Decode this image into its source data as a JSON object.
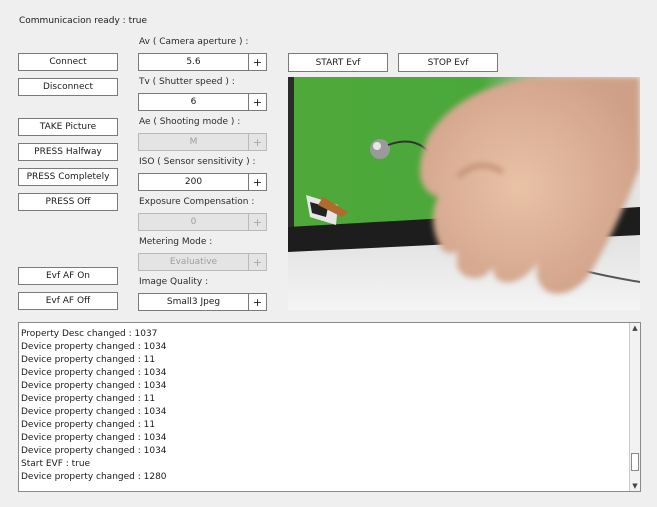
{
  "status": {
    "text": "Communicacion ready : true"
  },
  "left_buttons": {
    "connect": "Connect",
    "disconnect": "Disconnect",
    "take_picture": "TAKE Picture",
    "press_halfway": "PRESS Halfway",
    "press_completely": "PRESS Completely",
    "press_off": "PRESS Off",
    "evf_af_on": "Evf AF On",
    "evf_af_off": "Evf AF Off"
  },
  "settings": {
    "av": {
      "label": "Av ( Camera aperture ) :",
      "value": "5.6",
      "enabled": true
    },
    "tv": {
      "label": "Tv ( Shutter speed ) :",
      "value": "6",
      "enabled": true
    },
    "ae": {
      "label": "Ae ( Shooting mode ) :",
      "value": "M",
      "enabled": false
    },
    "iso": {
      "label": "ISO ( Sensor sensitivity ) :",
      "value": "200",
      "enabled": true
    },
    "exposure": {
      "label": "Exposure Compensation :",
      "value": "0",
      "enabled": false
    },
    "metering": {
      "label": "Metering Mode :",
      "value": "Evaluative",
      "enabled": false
    },
    "quality": {
      "label": "Image Quality :",
      "value": "Small3 Jpeg",
      "enabled": true
    },
    "plus_label": "+"
  },
  "evf_buttons": {
    "start": "START Evf",
    "stop": "STOP Evf"
  },
  "log": {
    "lines": [
      "Property Desc changed : 1037",
      "Device property changed : 1034",
      "Device property changed : 11",
      "Device property changed : 1034",
      "Device property changed : 1034",
      "Device property changed : 11",
      "Device property changed : 1034",
      "Device property changed : 11",
      "Device property changed : 1034",
      "Device property changed : 1034",
      "Start EVF : true",
      "Device property changed : 1280"
    ]
  },
  "icons": {
    "scroll_up": "scroll-up-arrow-icon",
    "scroll_down": "scroll-down-arrow-icon"
  }
}
